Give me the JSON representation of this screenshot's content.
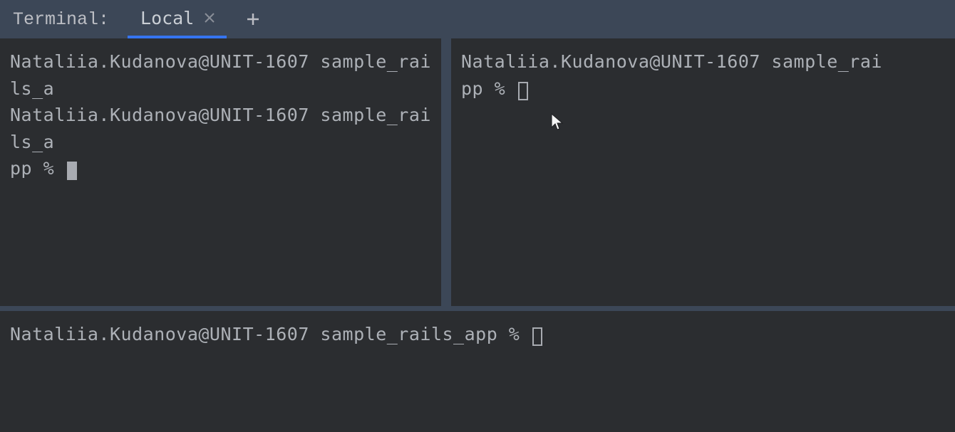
{
  "header": {
    "title": "Terminal:",
    "tabs": [
      {
        "label": "Local",
        "active": true
      }
    ]
  },
  "panes": {
    "topLeft": {
      "line1": "Nataliia.Kudanova@UNIT-1607 sample_rails_a",
      "line2": "Nataliia.Kudanova@UNIT-1607 sample_rails_a",
      "line3": "pp % "
    },
    "topRight": {
      "line1": "Nataliia.Kudanova@UNIT-1607 sample_rai",
      "line2": "pp % "
    },
    "bottom": {
      "line1": "Nataliia.Kudanova@UNIT-1607 sample_rails_app % "
    }
  }
}
